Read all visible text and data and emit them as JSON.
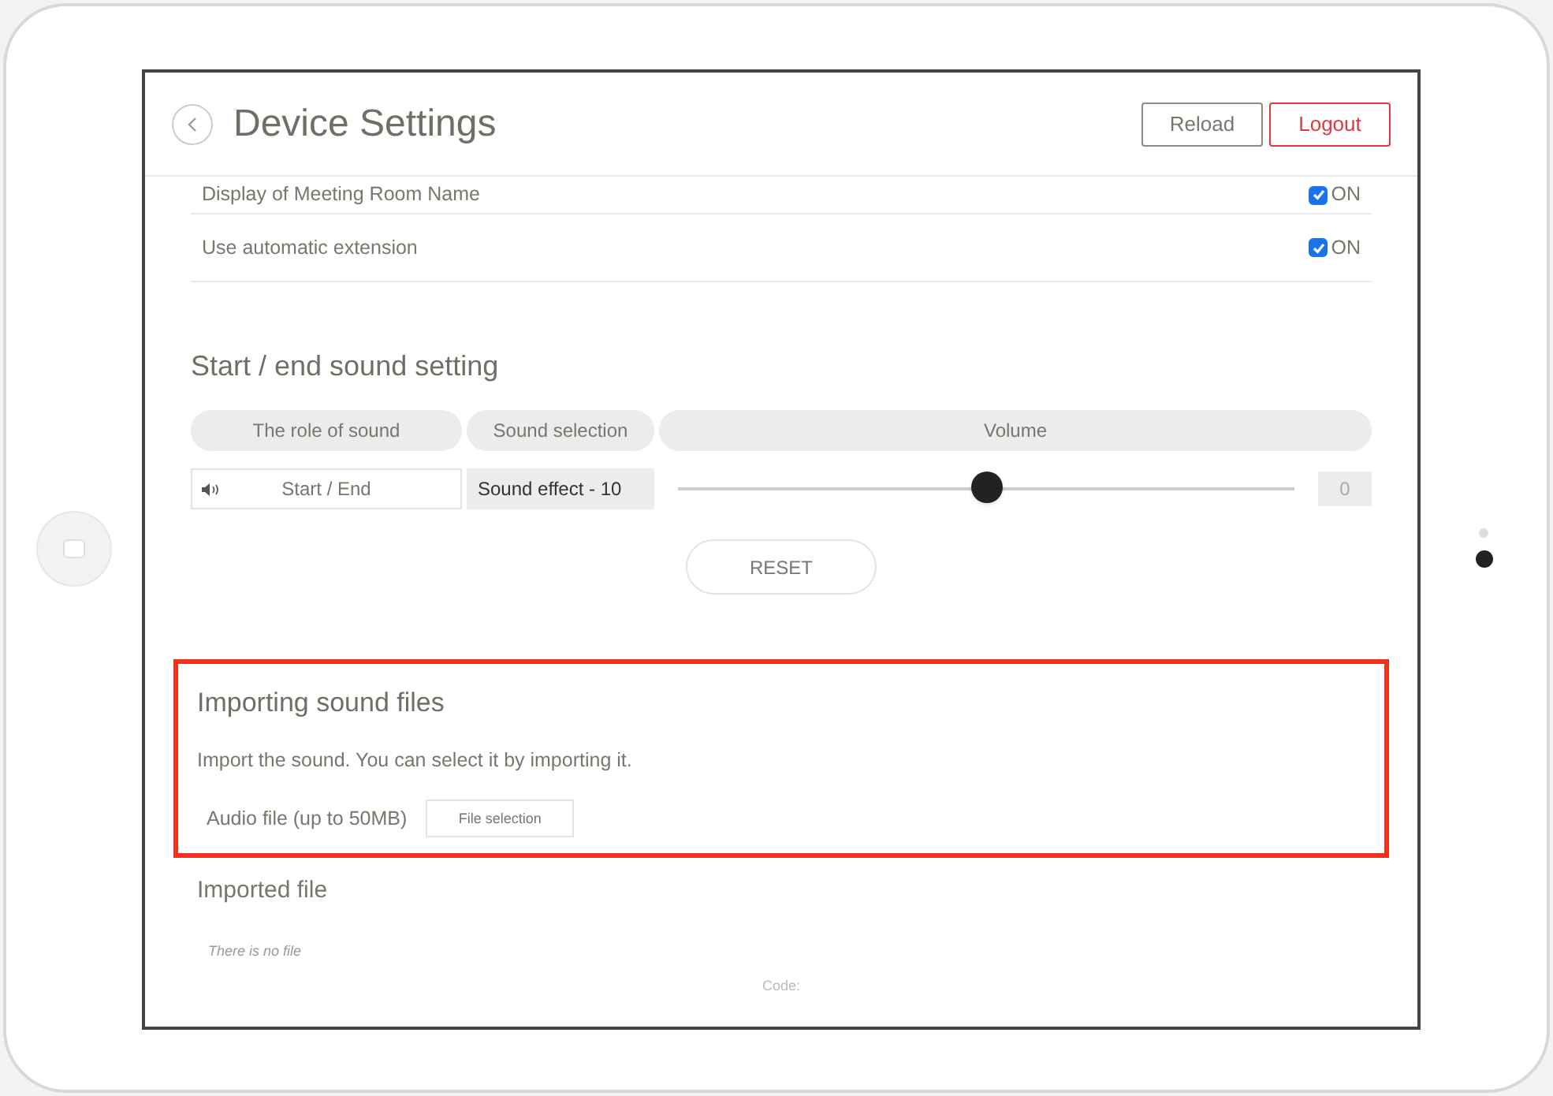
{
  "header": {
    "title": "Device Settings",
    "buttons": [
      {
        "label": "Reload",
        "kind": "neutral"
      },
      {
        "label": "Logout",
        "kind": "danger"
      }
    ]
  },
  "settings": [
    {
      "label": "Display of Meeting Room Name",
      "checked": true,
      "value": "ON"
    },
    {
      "label": "Use automatic extension",
      "checked": true,
      "value": "ON"
    }
  ],
  "sound_setting": {
    "title": "Start / end sound setting",
    "columns": [
      "The role of sound",
      "Sound selection",
      "Volume"
    ],
    "rows": [
      {
        "role": "Start / End",
        "selection": "Sound effect - 10",
        "level": 0.5,
        "reading": "0"
      }
    ],
    "reset": "RESET"
  },
  "import": {
    "title": "Importing sound files",
    "highlighted": true,
    "description": "Import the sound. You can select it by importing it.",
    "field_label": "Audio file (up to 50MB)",
    "button": "File selection"
  },
  "imported": {
    "title": "Imported file",
    "empty_text": "There is no file",
    "code_label": "Code:"
  }
}
